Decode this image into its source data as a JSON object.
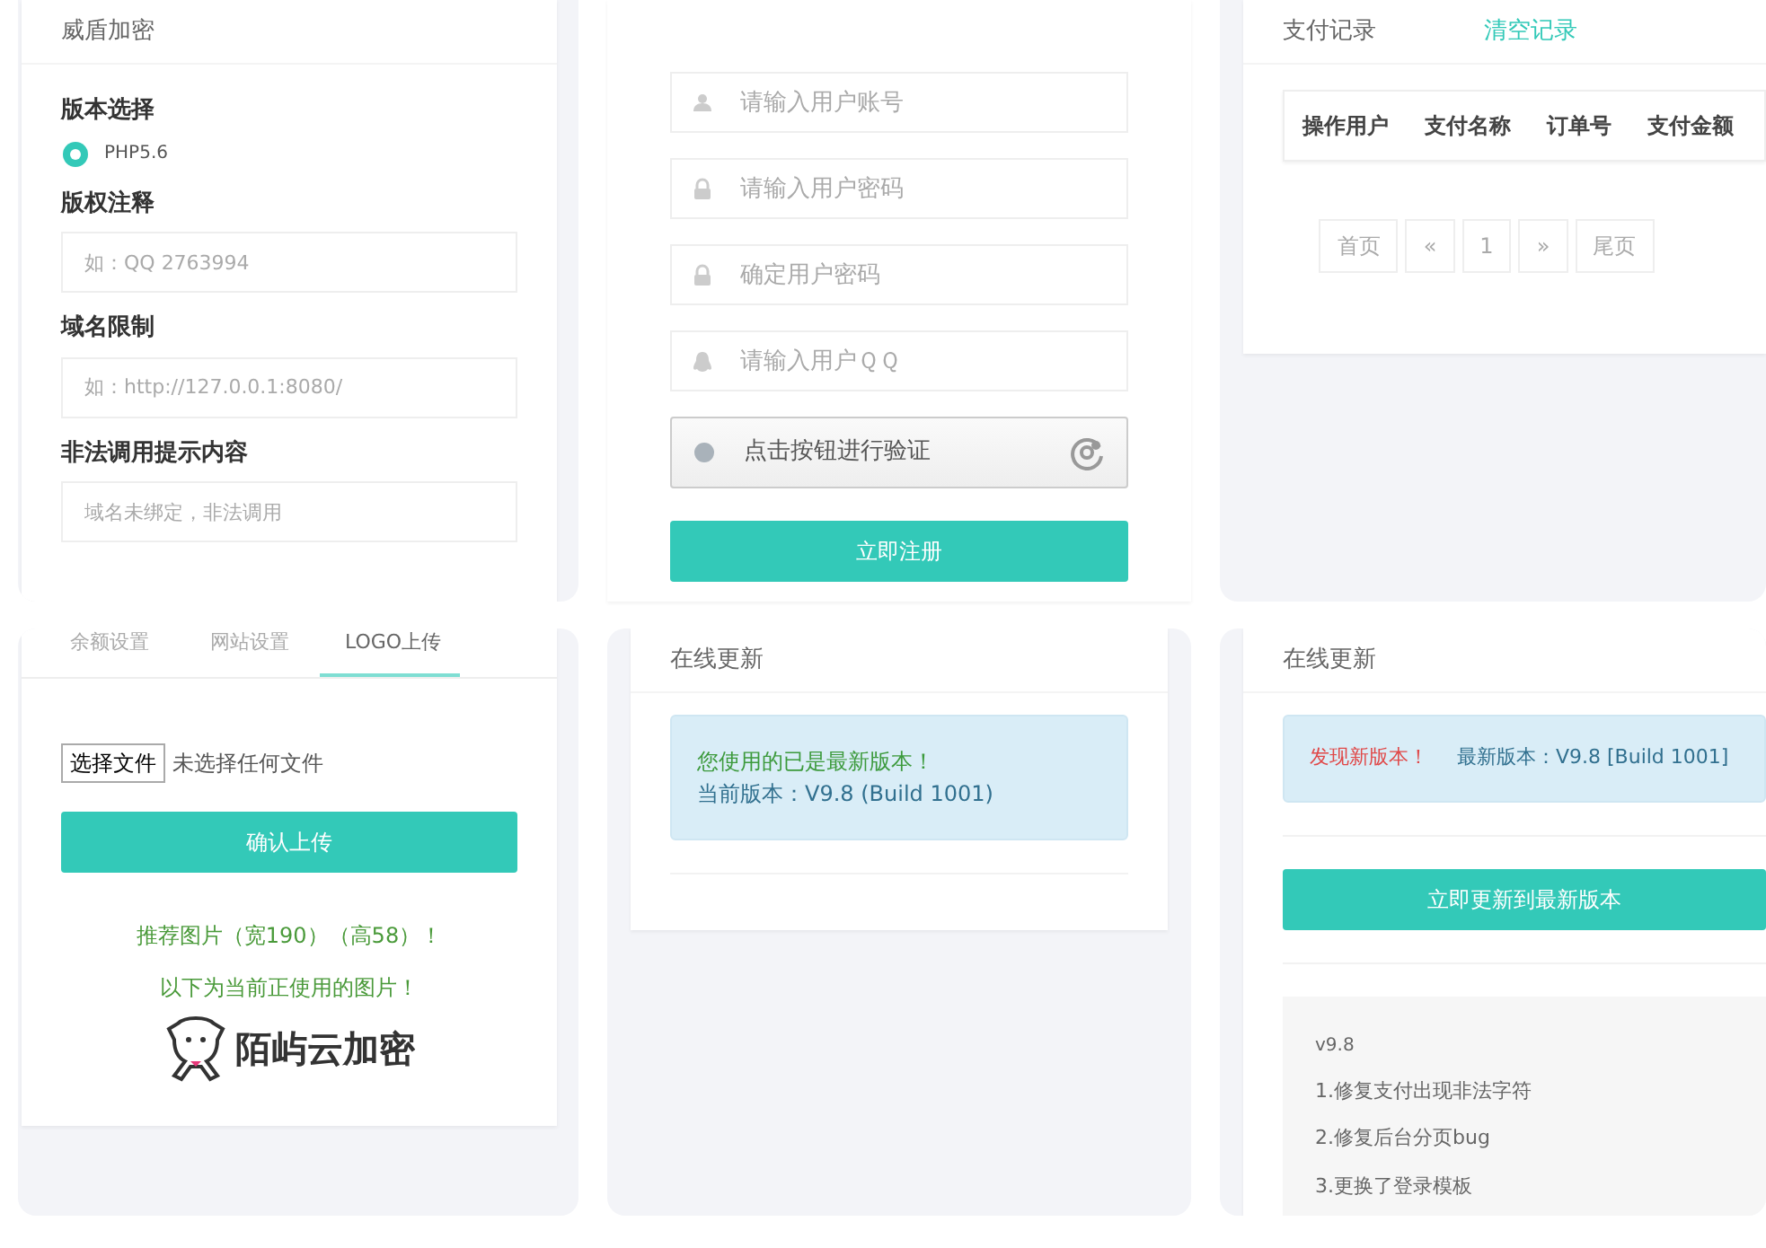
{
  "encryption_panel": {
    "title": "威盾加密",
    "sections": [
      {
        "label": "版本选择",
        "kind": "radio",
        "options": [
          {
            "label": "PHP5.6",
            "selected": true
          }
        ]
      },
      {
        "label": "版权注释",
        "kind": "field",
        "placeholder": "如：QQ 2763994"
      },
      {
        "label": "域名限制",
        "kind": "field",
        "placeholder": "如：http://127.0.0.1:8080/"
      },
      {
        "label": "非法调用提示内容",
        "kind": "field",
        "placeholder": "域名未绑定，非法调用"
      }
    ]
  },
  "register_panel": {
    "fields": [
      {
        "kind": "user",
        "placeholder": "请输入用户账号"
      },
      {
        "kind": "lock",
        "placeholder": "请输入用户密码"
      },
      {
        "kind": "lock",
        "placeholder": "确定用户密码"
      },
      {
        "kind": "penguin",
        "placeholder": "请输入用户ＱＱ"
      }
    ],
    "captcha": "点击按钮进行验证",
    "submit": "立即注册"
  },
  "payments_panel": {
    "title": "支付记录",
    "clear_link": "清空记录",
    "columns": [
      "操作用户",
      "支付名称",
      "订单号",
      "支付金额"
    ],
    "pagination": [
      "首页",
      "«",
      "1",
      "»",
      "尾页"
    ]
  },
  "logo_panel": {
    "tabs": [
      {
        "label": "余额设置",
        "selected": false
      },
      {
        "label": "网站设置",
        "selected": false
      },
      {
        "label": "LOGO上传",
        "selected": true
      }
    ],
    "file_button": "选择文件",
    "file_status": "未选择任何文件",
    "upload_button": "确认上传",
    "hints": [
      "推荐图片（宽190）（高58）！",
      "以下为当前正使用的图片！"
    ],
    "logo_text": "陌屿云加密"
  },
  "update_latest": {
    "title": "在线更新",
    "message": "您使用的已是最新版本！",
    "version": "当前版本：V9.8 (Build 1001)"
  },
  "update_new": {
    "title": "在线更新",
    "message": "发现新版本！",
    "version": "最新版本：V9.8 [Build 1001]",
    "button": "立即更新到最新版本",
    "changelog": [
      "v9.8",
      "1.修复支付出现非法字符",
      "2.修复后台分页bug",
      "3.更换了登录模板"
    ]
  }
}
